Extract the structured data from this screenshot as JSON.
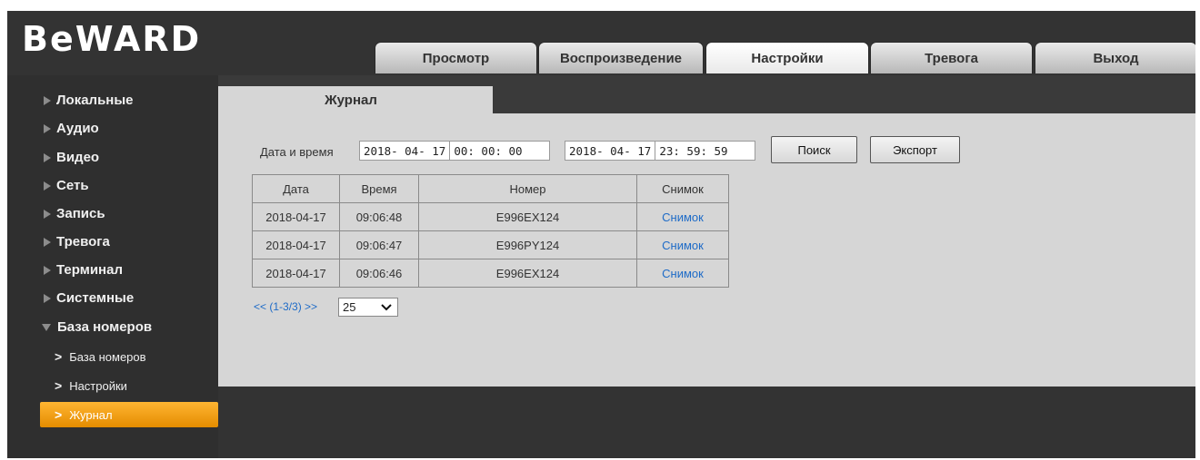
{
  "brand": {
    "logo": "BeWARD"
  },
  "tabs": [
    {
      "label": "Просмотр"
    },
    {
      "label": "Воспроизведение"
    },
    {
      "label": "Настройки"
    },
    {
      "label": "Тревога"
    },
    {
      "label": "Выход"
    }
  ],
  "sidebar": {
    "items": [
      {
        "label": "Локальные"
      },
      {
        "label": "Аудио"
      },
      {
        "label": "Видео"
      },
      {
        "label": "Сеть"
      },
      {
        "label": "Запись"
      },
      {
        "label": "Тревога"
      },
      {
        "label": "Терминал"
      },
      {
        "label": "Системные"
      },
      {
        "label": "База номеров"
      }
    ],
    "subitems": [
      {
        "label": "База номеров"
      },
      {
        "label": "Настройки"
      },
      {
        "label": "Журнал"
      }
    ]
  },
  "panel": {
    "title": "Журнал",
    "datetime_label": "Дата и время",
    "from": {
      "date": "2018- 04- 17",
      "time": "00: 00: 00"
    },
    "to": {
      "date": "2018- 04- 17",
      "time": "23: 59: 59"
    },
    "search_label": "Поиск",
    "export_label": "Экспорт"
  },
  "table": {
    "headers": [
      "Дата",
      "Время",
      "Номер",
      "Снимок"
    ],
    "rows": [
      [
        "2018-04-17",
        "09:06:48",
        "E996EX124",
        "Снимок"
      ],
      [
        "2018-04-17",
        "09:06:47",
        "E996PY124",
        "Снимок"
      ],
      [
        "2018-04-17",
        "09:06:46",
        "E996EX124",
        "Снимок"
      ]
    ]
  },
  "pager": {
    "prev": "<<",
    "range": "(1-3/3)",
    "next": ">>",
    "page_size": "25"
  },
  "colors": {
    "accent": "#f0a010",
    "link": "#1e6bc7",
    "background": "#3a3a3a",
    "panel": "#d6d6d6"
  }
}
